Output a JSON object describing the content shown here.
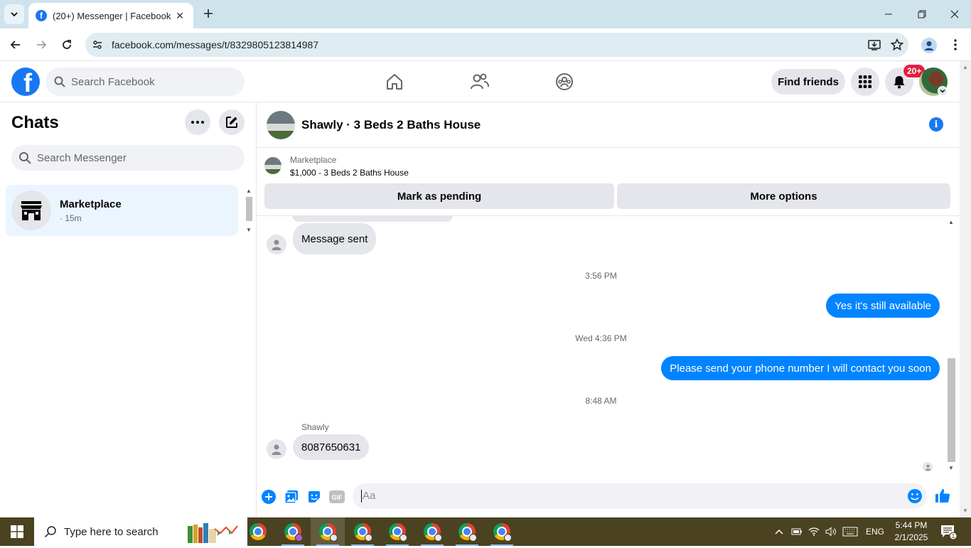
{
  "browser": {
    "tab_title": "(20+) Messenger | Facebook",
    "url": "facebook.com/messages/t/8329805123814987"
  },
  "fb_header": {
    "search_placeholder": "Search Facebook",
    "find_friends_label": "Find friends",
    "notification_count": "20+"
  },
  "sidebar": {
    "title": "Chats",
    "search_placeholder": "Search Messenger",
    "chats": [
      {
        "name": "Marketplace",
        "time": "· 15m"
      }
    ]
  },
  "conversation": {
    "title": "Shawly · 3 Beds 2 Baths House",
    "listing_label": "Marketplace",
    "listing_price": "$1,000 - 3 Beds 2 Baths House",
    "mark_pending_label": "Mark as pending",
    "more_options_label": "More options",
    "messages": [
      {
        "direction": "in",
        "text": "Message sent"
      },
      {
        "timestamp": "3:56 PM"
      },
      {
        "direction": "out",
        "text": "Yes it's still available"
      },
      {
        "timestamp": "Wed 4:36 PM"
      },
      {
        "direction": "out",
        "text": "Please send your phone number I will contact you soon"
      },
      {
        "timestamp": "8:48 AM"
      },
      {
        "direction": "in",
        "sender": "Shawly",
        "text": "8087650631"
      }
    ],
    "composer_placeholder": "Aa"
  },
  "taskbar": {
    "search_placeholder": "Type here to search",
    "language": "ENG",
    "time": "5:44 PM",
    "date": "2/1/2025",
    "notification_count": "1"
  },
  "colors": {
    "fb_blue": "#1877f2",
    "outgoing_bubble": "#0084ff",
    "incoming_bubble": "#e4e6eb",
    "notification_red": "#e41e3f",
    "selected_chat": "#ebf5ff",
    "taskbar": "#4a4220"
  }
}
